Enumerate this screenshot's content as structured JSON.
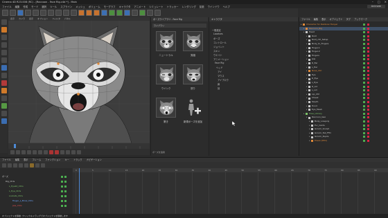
{
  "window": {
    "title": "Cinema 4D R23.008 (RC) - [Raccoon - Face Rig.c4d *] - Main"
  },
  "menu": {
    "items": [
      "ファイル",
      "編集",
      "作成",
      "モード",
      "選択",
      "ツール",
      "スプライン",
      "メッシュ",
      "ボリューム",
      "モーグラフ",
      "キャラクタ",
      "アニメート",
      "シミュレート",
      "トラッカー",
      "レンダリング",
      "拡張",
      "ウインドウ",
      "ヘルプ"
    ],
    "workspace": "Animate"
  },
  "viewport": {
    "menu": [
      "表示",
      "カメラ",
      "表示",
      "オプション",
      "フィルタ",
      "パネル"
    ]
  },
  "asset_panel": {
    "header": "ポーズライブラリ - Face Rig",
    "path": "ライブラリ",
    "tiles": [
      {
        "label": "ニュートラル"
      },
      {
        "label": "笑顔"
      },
      {
        "label": "ウインク"
      },
      {
        "label": "怒り"
      },
      {
        "label": "驚き"
      },
      {
        "label": "新規ポーズを追加"
      }
    ],
    "footer": "ポーズを適用"
  },
  "tree": {
    "header": "キャラクタ",
    "items": [
      "一般設定",
      "Locators",
      "ポーズ",
      "コントロール",
      "ジョイント",
      "スキン",
      "ウエイト",
      "アニメーション",
      "Face Rig",
      "ヘッド",
      "アイ",
      "マウス",
      "アイブロウ",
      "鼻",
      "耳"
    ]
  },
  "object_manager": {
    "menu": [
      "ファイル",
      "編集",
      "表示",
      "オブジェクト",
      "タグ",
      "ブックマーク"
    ],
    "rows": [
      {
        "name": "Character for Rainbow Hooyar",
        "indent": 0,
        "selected": false,
        "color": "#e08a3a"
      },
      {
        "name": "Raccoon_Rig",
        "indent": 1,
        "selected": true,
        "color": "#e08a3a"
      },
      {
        "name": "Head",
        "indent": 1,
        "selected": false,
        "color": "#c9c9c9"
      },
      {
        "name": "Root",
        "indent": 2,
        "selected": false,
        "color": "#c9c9c9"
      },
      {
        "name": "Root_ctrl_Setup",
        "indent": 2,
        "selected": false,
        "color": "#c9c9c9"
      },
      {
        "name": "Body_to_Fingers",
        "indent": 2,
        "selected": false,
        "color": "#c9c9c9"
      },
      {
        "name": "Finger.1",
        "indent": 2,
        "selected": false,
        "color": "#c9c9c9"
      },
      {
        "name": "Finger.2",
        "indent": 2,
        "selected": false,
        "color": "#c9c9c9"
      },
      {
        "name": "Fingers",
        "indent": 2,
        "selected": false,
        "color": "#c9c9c9"
      },
      {
        "name": "Jaw",
        "indent": 2,
        "selected": false,
        "color": "#c9c9c9"
      },
      {
        "name": "R_Ear",
        "indent": 2,
        "selected": false,
        "color": "#c9c9c9"
      },
      {
        "name": "L_Ear",
        "indent": 2,
        "selected": false,
        "color": "#c9c9c9"
      },
      {
        "name": "Nose_Ctrl",
        "indent": 2,
        "selected": false,
        "color": "#e08a3a"
      },
      {
        "name": "Eye",
        "indent": 2,
        "selected": false,
        "color": "#c9c9c9"
      },
      {
        "name": "R_Eye",
        "indent": 2,
        "selected": false,
        "color": "#c9c9c9"
      },
      {
        "name": "L_Eye",
        "indent": 2,
        "selected": false,
        "color": "#c9c9c9"
      },
      {
        "name": "R_Lid",
        "indent": 2,
        "selected": false,
        "color": "#c9c9c9"
      },
      {
        "name": "L_Lid",
        "indent": 2,
        "selected": false,
        "color": "#c9c9c9"
      },
      {
        "name": "Lip_Ctrl",
        "indent": 2,
        "selected": false,
        "color": "#c9c9c9"
      },
      {
        "name": "Cheek",
        "indent": 2,
        "selected": false,
        "color": "#c9c9c9"
      },
      {
        "name": "Mouth",
        "indent": 2,
        "selected": false,
        "color": "#c9c9c9"
      },
      {
        "name": "Hood",
        "indent": 2,
        "selected": false,
        "color": "#c9c9c9"
      },
      {
        "name": "Eye_Mesh",
        "indent": 2,
        "selected": false,
        "color": "#c9c9c9"
      },
      {
        "name": "Pose_Library",
        "indent": 1,
        "selected": false,
        "color": "#7dc36a"
      },
      {
        "name": "Raccoon_Geo",
        "indent": 2,
        "selected": false,
        "color": "#c9c9c9"
      },
      {
        "name": "Body_Lowpoly",
        "indent": 3,
        "selected": false,
        "color": "#c9c9c9"
      },
      {
        "name": "Fur_Cards",
        "indent": 3,
        "selected": false,
        "color": "#c9c9c9"
      },
      {
        "name": "Groom_Sculpt",
        "indent": 3,
        "selected": false,
        "color": "#c9c9c9"
      },
      {
        "name": "Groom_Tail_FFD",
        "indent": 3,
        "selected": false,
        "color": "#c9c9c9"
      },
      {
        "name": "Groom_Pupils",
        "indent": 3,
        "selected": false,
        "color": "#c9c9c9"
      },
      {
        "name": "Poses (Dfm)",
        "indent": 3,
        "selected": false,
        "color": "#e08a3a"
      }
    ]
  },
  "timeline": {
    "menu": [
      "ファイル",
      "編集",
      "表示",
      "フレーム",
      "ファンクション",
      "キー",
      "トラック",
      "ナビゲーション"
    ],
    "rows": [
      {
        "name": "ポーズ",
        "indent": 0,
        "color": "#c9c9c9"
      },
      {
        "name": "Rig_Ctrls",
        "indent": 1,
        "color": "#c9c9c9"
      },
      {
        "name": "L_Eyelid_Ctrls",
        "indent": 2,
        "color": "#7dc36a"
      },
      {
        "name": "L_Eye_Ctrls",
        "indent": 2,
        "color": "#7dc36a"
      },
      {
        "name": "Lookats_Ctrls",
        "indent": 2,
        "color": "#7dc36a"
      },
      {
        "name": "Finger_L_Brow_Ctrls",
        "indent": 3,
        "color": "#6fa8ff"
      },
      {
        "name": "Jaw_Ctrls",
        "indent": 3,
        "color": "#e05050"
      }
    ],
    "ruler": [
      "0",
      "5",
      "10",
      "15",
      "20",
      "25",
      "30",
      "35",
      "40",
      "45",
      "50",
      "55",
      "60",
      "65",
      "70",
      "75",
      "80",
      "85",
      "90"
    ]
  },
  "status": "オブジェクトを移動: クリック＆ドラッグでオブジェクトを移動します"
}
